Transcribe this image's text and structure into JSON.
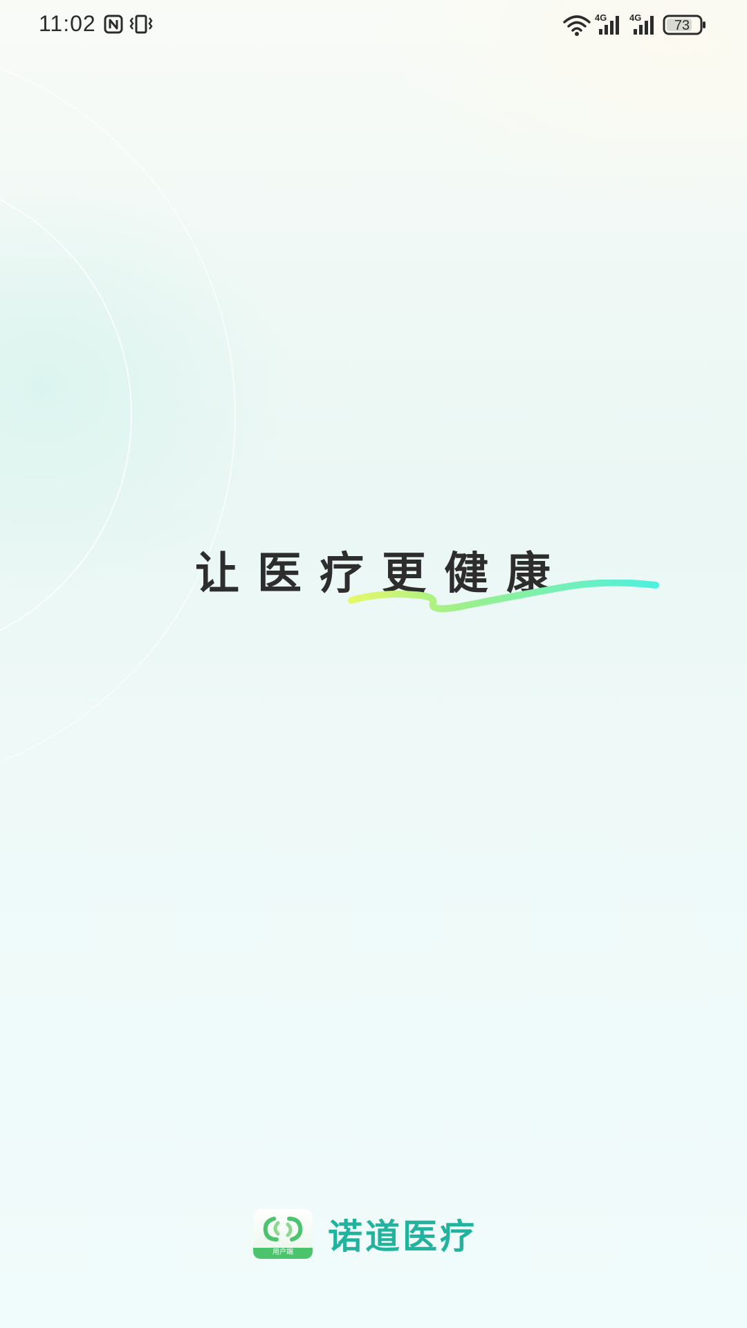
{
  "status_bar": {
    "time": "11:02",
    "battery_level": "73",
    "icons": [
      "nfc-icon",
      "vibrate-icon",
      "wifi-icon",
      "signal-4g-icon",
      "signal-4g-icon",
      "battery-icon"
    ]
  },
  "splash": {
    "slogan": "让医疗更健康"
  },
  "brand": {
    "logo_caption": "用户端",
    "name": "诺道医疗"
  },
  "colors": {
    "brand_primary": "#22b39f",
    "logo_green": "#4cc46e",
    "swoosh_start": "#d6f75e",
    "swoosh_end": "#4ef0df",
    "text_dark": "#2d2d2d"
  }
}
